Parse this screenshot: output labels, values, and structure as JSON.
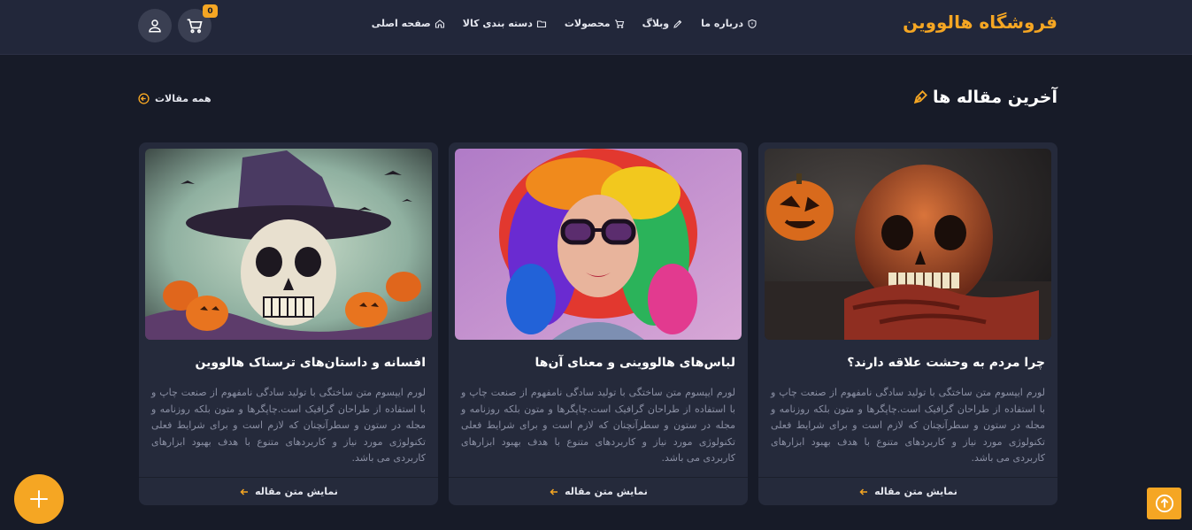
{
  "colors": {
    "accent": "#f5a623",
    "background": "#171b28",
    "header": "#22273a",
    "card": "#252a3b"
  },
  "header": {
    "brand": "فروشگاه هالووین",
    "nav": [
      {
        "label": "صفحه اصلی",
        "icon": "home-icon"
      },
      {
        "label": "دسته بندی کالا",
        "icon": "folder-icon"
      },
      {
        "label": "محصولات",
        "icon": "cart-icon"
      },
      {
        "label": "وبلاگ",
        "icon": "pen-icon"
      },
      {
        "label": "درباره ما",
        "icon": "shield-icon"
      }
    ],
    "cart_count": "0",
    "cart_icon": "cart-icon",
    "user_icon": "user-icon"
  },
  "section": {
    "title": "آخرین مقاله ها",
    "title_icon": "pen-nib-icon",
    "all_link": "همه مقالات",
    "all_link_icon": "arrow-left-circle-icon"
  },
  "articles": [
    {
      "image": "pumpkins-and-red-skull-photo",
      "title": "چرا مردم به وحشت علاقه دارند؟",
      "excerpt": "لورم ایپسوم متن ساختگی با تولید سادگی نامفهوم از صنعت چاپ و با استفاده از طراحان گرافیک است.چاپگرها و متون بلکه روزنامه و مجله در ستون و سطرآنچنان که لازم است و برای شرایط فعلی تکنولوژی مورد نیاز و کاربردهای متنوع با هدف بهبود ابزارهای کاربردی می باشد.",
      "link": "نمایش متن مقاله"
    },
    {
      "image": "woman-rainbow-hair-photo",
      "title": "لباس‌های هالووینی و معنای آن‌ها",
      "excerpt": "لورم ایپسوم متن ساختگی با تولید سادگی نامفهوم از صنعت چاپ و با استفاده از طراحان گرافیک است.چاپگرها و متون بلکه روزنامه و مجله در ستون و سطرآنچنان که لازم است و برای شرایط فعلی تکنولوژی مورد نیاز و کاربردهای متنوع با هدف بهبود ابزارهای کاربردی می باشد.",
      "link": "نمایش متن مقاله"
    },
    {
      "image": "skull-witch-hat-illustration",
      "title": "افسانه و داستان‌های ترسناک هالووین",
      "excerpt": "لورم ایپسوم متن ساختگی با تولید سادگی نامفهوم از صنعت چاپ و با استفاده از طراحان گرافیک است.چاپگرها و متون بلکه روزنامه و مجله در ستون و سطرآنچنان که لازم است و برای شرایط فعلی تکنولوژی مورد نیاز و کاربردهای متنوع با هدف بهبود ابزارهای کاربردی می باشد.",
      "link": "نمایش متن مقاله"
    }
  ],
  "fab_icon": "plus-icon",
  "scroll_top_icon": "arrow-up-circle-icon"
}
